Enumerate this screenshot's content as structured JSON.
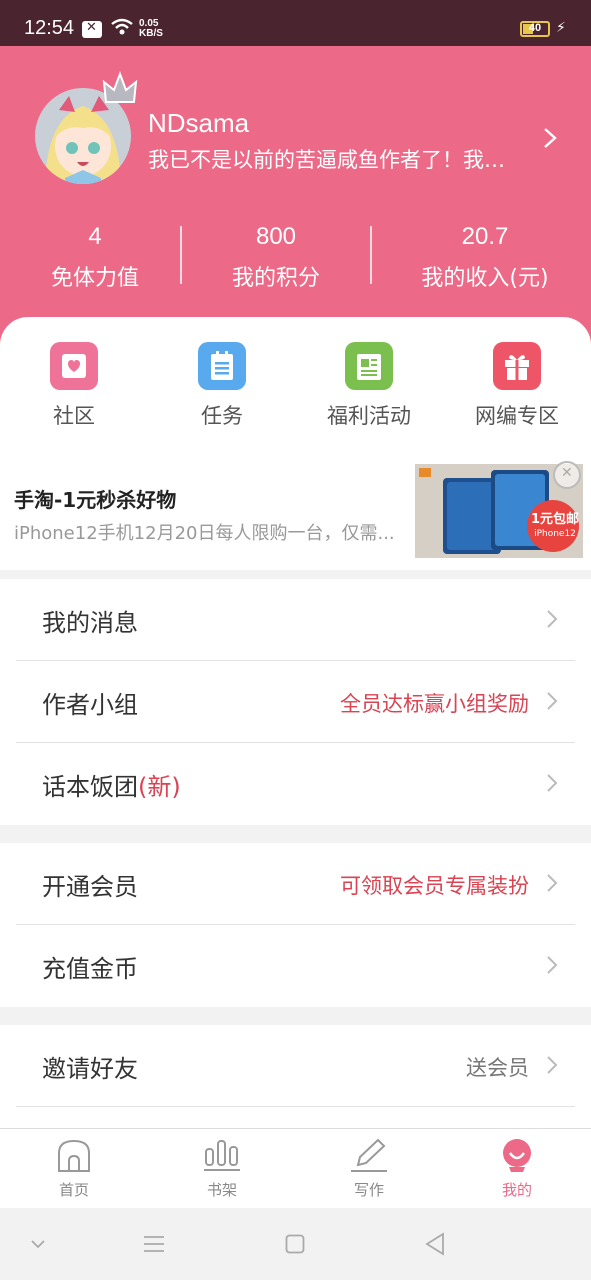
{
  "status_bar": {
    "time": "12:54",
    "speed_top": "0.05",
    "speed_unit": "KB/S",
    "battery": "40"
  },
  "profile": {
    "username": "NDsama",
    "bio": "我已不是以前的苦逼咸鱼作者了！我…"
  },
  "stats": [
    {
      "value": "4",
      "label": "免体力值"
    },
    {
      "value": "800",
      "label": "我的积分"
    },
    {
      "value": "20.7",
      "label": "我的收入(元)"
    }
  ],
  "quick_links": [
    {
      "label": "社区",
      "color": "#ef7299"
    },
    {
      "label": "任务",
      "color": "#58a9ee"
    },
    {
      "label": "福利活动",
      "color": "#7bbf4e"
    },
    {
      "label": "网编专区",
      "color": "#ee5667"
    }
  ],
  "ad": {
    "title": "手淘-1元秒杀好物",
    "description": "iPhone12手机12月20日每人限购一台，仅需...",
    "badge_line1": "1元包邮",
    "badge_line2": "iPhone12"
  },
  "menu_group1": [
    {
      "label": "我的消息",
      "extra": ""
    },
    {
      "label": "作者小组",
      "extra": "全员达标赢小组奖励"
    },
    {
      "label": "话本饭团",
      "tag": "(新)",
      "extra": ""
    }
  ],
  "menu_group2": [
    {
      "label": "开通会员",
      "extra": "可领取会员专属装扮"
    },
    {
      "label": "充值金币",
      "extra": ""
    }
  ],
  "menu_group3": [
    {
      "label": "邀请好友",
      "extra": "送会员"
    }
  ],
  "bottom_nav": [
    {
      "label": "首页",
      "active": false
    },
    {
      "label": "书架",
      "active": false
    },
    {
      "label": "写作",
      "active": false
    },
    {
      "label": "我的",
      "active": true
    }
  ],
  "colors": {
    "header": "#ec6a88",
    "status_bar": "#4a2530",
    "accent_red": "#d94352"
  }
}
